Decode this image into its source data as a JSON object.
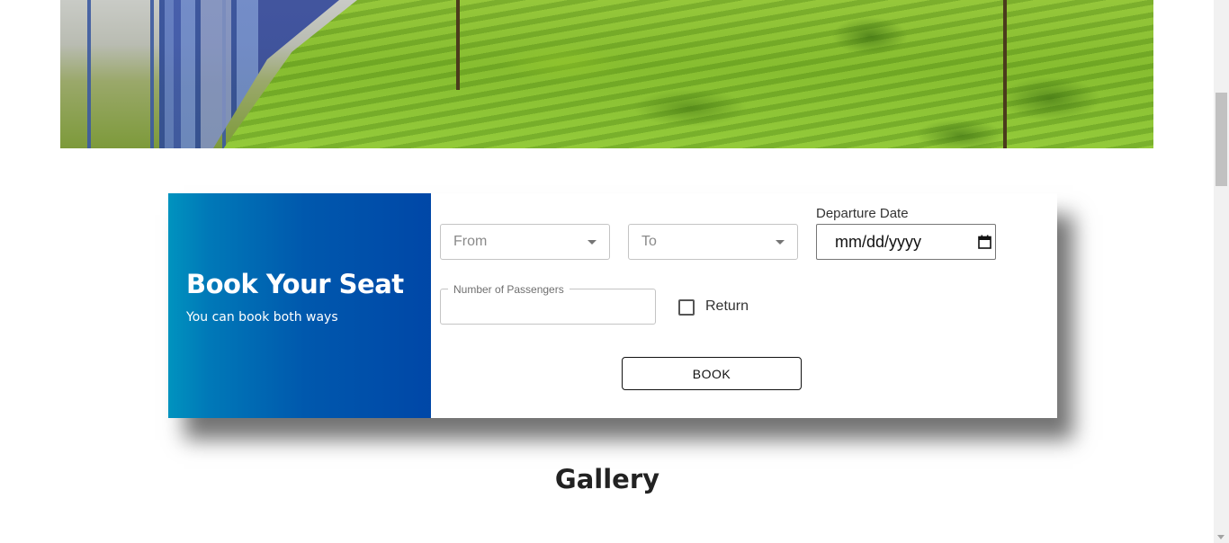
{
  "hero": {
    "image_name": "train-through-tea-plantation-image"
  },
  "booking": {
    "title": "Book Your Seat",
    "subtitle": "You can book both ways",
    "from_placeholder": "From",
    "to_placeholder": "To",
    "departure_label": "Departure Date",
    "date_placeholder": "mm/dd/yyyy",
    "passengers_label": "Number of Passengers",
    "passengers_value": "",
    "return_label": "Return",
    "return_checked": false,
    "book_label": "BOOK"
  },
  "gallery": {
    "title": "Gallery"
  },
  "colors": {
    "panel_gradient_start": "#0093bf",
    "panel_gradient_end": "#0047a7"
  }
}
